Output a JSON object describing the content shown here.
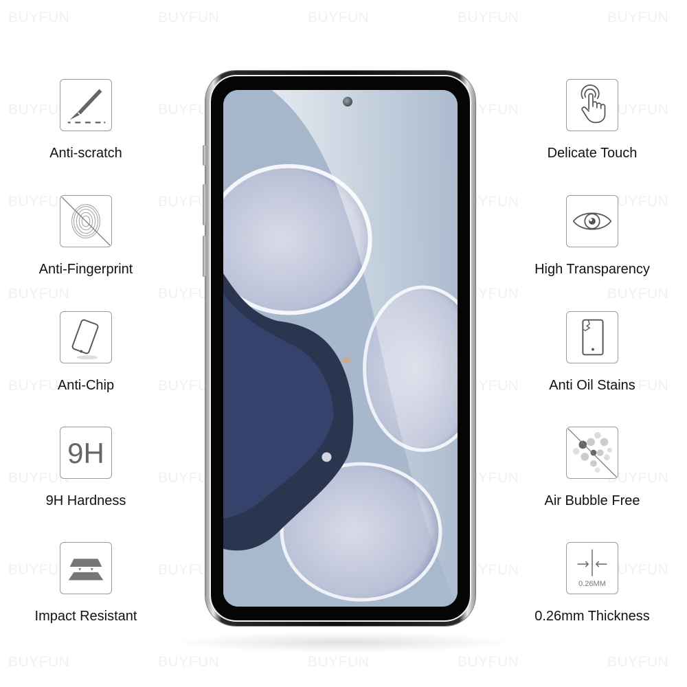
{
  "watermark": {
    "text": "BUYFUN",
    "color": "#f1f1f1"
  },
  "features_left": [
    {
      "icon": "scalpel-icon",
      "label": "Anti-scratch"
    },
    {
      "icon": "fingerprint-crossed-icon",
      "label": "Anti-Fingerprint"
    },
    {
      "icon": "tilted-phone-icon",
      "label": "Anti-Chip"
    },
    {
      "icon": "9h-icon",
      "icon_text": "9H",
      "label": "9H Hardness"
    },
    {
      "icon": "impact-layers-icon",
      "label": "Impact Resistant"
    }
  ],
  "features_right": [
    {
      "icon": "touch-hand-icon",
      "label": "Delicate Touch"
    },
    {
      "icon": "eye-icon",
      "label": "High Transparency"
    },
    {
      "icon": "cracked-phone-icon",
      "label": "Anti Oil Stains"
    },
    {
      "icon": "bubbles-crossed-icon",
      "label": "Air Bubble Free"
    },
    {
      "icon": "thickness-arrows-icon",
      "icon_text": "0.26MM",
      "label": "0.26mm Thickness"
    }
  ],
  "colors": {
    "icon_stroke": "#9a9a9a",
    "icon_fill": "#666666",
    "label_text": "#111111",
    "screen_bg": "#a7b8cc"
  }
}
